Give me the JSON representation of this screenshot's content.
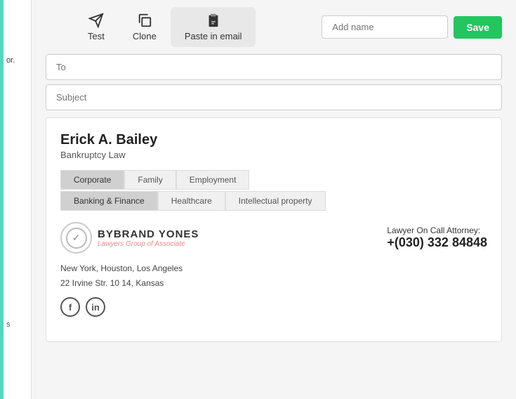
{
  "sidebar": {
    "accent_color": "#4dd9c0",
    "text": "or.",
    "bottom_text": "s"
  },
  "toolbar": {
    "buttons": [
      {
        "id": "test",
        "label": "Test",
        "icon": "send-icon",
        "active": false
      },
      {
        "id": "clone",
        "label": "Clone",
        "icon": "clone-icon",
        "active": false
      },
      {
        "id": "paste-in-email",
        "label": "Paste in email",
        "icon": "paste-icon",
        "active": true
      }
    ],
    "name_input_placeholder": "Add name",
    "save_label": "Save"
  },
  "email_composer": {
    "to_placeholder": "To",
    "subject_placeholder": "Subject"
  },
  "signature": {
    "name": "Erick A. Bailey",
    "title": "Bankruptcy Law",
    "tags_row1": [
      "Corporate",
      "Family",
      "Employment"
    ],
    "tags_row2": [
      "Banking & Finance",
      "Healthcare",
      "Intellectual property"
    ],
    "logo": {
      "brand": "BYBRAND YONES",
      "sub": "Lawyers Group of Associate"
    },
    "contact_label": "Lawyer On Call Attorney:",
    "contact_phone": "+(030) 332 84848",
    "address_line1": "New York, Houston, Los Angeles",
    "address_line2": "22 Irvine Str. 10 14, Kansas",
    "social": [
      {
        "id": "facebook",
        "symbol": "f"
      },
      {
        "id": "linkedin",
        "symbol": "in"
      }
    ]
  }
}
